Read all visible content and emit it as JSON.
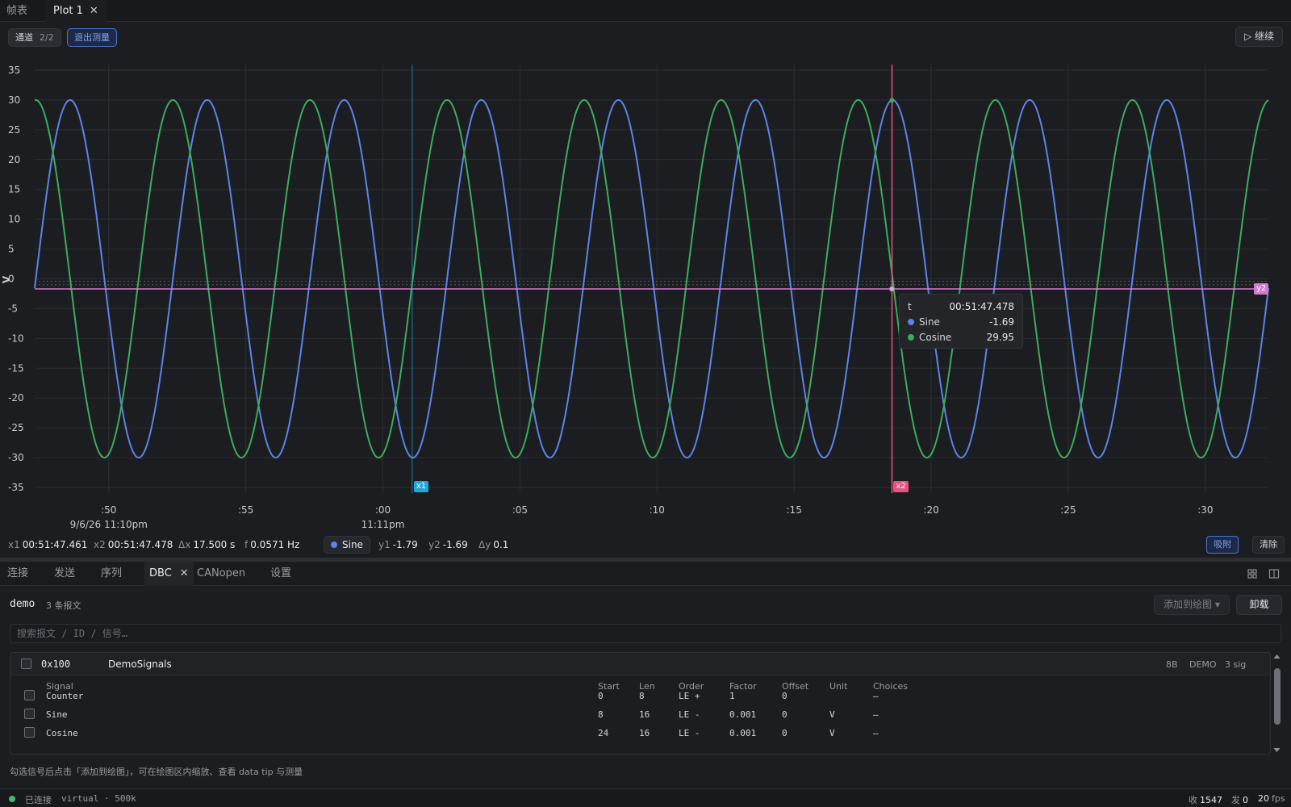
{
  "top_tabs": [
    {
      "label": "帧表",
      "active": false
    },
    {
      "label": "Plot 1",
      "active": true,
      "close": "✕"
    }
  ],
  "toolbar": {
    "channel_label": "通道",
    "channel_count": "2/2",
    "measure_exit_label": "退出测量",
    "continue_label": "▷ 继续"
  },
  "chart_data": {
    "type": "line",
    "ylabel": "V",
    "ylim": [
      -35,
      35
    ],
    "yticks": [
      35,
      30,
      25,
      20,
      15,
      10,
      5,
      0,
      -5,
      -10,
      -15,
      -20,
      -25,
      -30,
      -35
    ],
    "x_range_s": [
      -12.7,
      32.3
    ],
    "xticks": [
      {
        "t": -10,
        "label": ":50",
        "sub": "9/6/26 11:10pm"
      },
      {
        "t": -5,
        "label": ":55"
      },
      {
        "t": 0,
        "label": ":00",
        "sub": "11:11pm"
      },
      {
        "t": 5,
        "label": ":05"
      },
      {
        "t": 10,
        "label": ":10"
      },
      {
        "t": 15,
        "label": ":15"
      },
      {
        "t": 20,
        "label": ":20"
      },
      {
        "t": 25,
        "label": ":25"
      },
      {
        "t": 30,
        "label": ":30"
      }
    ],
    "series": [
      {
        "name": "Sine",
        "color": "#5b84e6",
        "amplitude": 30,
        "frequency_hz": 0.2,
        "phase_deg": -3
      },
      {
        "name": "Cosine",
        "color": "#3dab5c",
        "amplitude": 30,
        "frequency_hz": 0.2,
        "phase_deg": 87
      }
    ],
    "grid": true,
    "cursors": {
      "x1": {
        "t": 1.07,
        "label": "x1",
        "color": "#22a6d8"
      },
      "x2": {
        "t": 18.57,
        "label": "x2",
        "color": "#e8527e"
      },
      "y2": {
        "value": -1.69,
        "label": "y2",
        "color": "#d27ad0"
      },
      "y1": {
        "value": -1.0
      }
    }
  },
  "tooltip": {
    "t_label": "t",
    "t_value": "00:51:47.478",
    "rows": [
      {
        "name": "Sine",
        "value": "-1.69",
        "color": "#5b84e6"
      },
      {
        "name": "Cosine",
        "value": "29.95",
        "color": "#3dab5c"
      }
    ]
  },
  "measure": {
    "x1_label": "x1",
    "x1_value": "00:51:47.461",
    "x2_label": "x2",
    "x2_value": "00:51:47.478",
    "dx_label": "Δx",
    "dx_value": "17.500 s",
    "f_label": "f",
    "f_value": "0.0571 Hz",
    "signal": "Sine",
    "y1_label": "y1",
    "y1_value": "-1.79",
    "y2_label": "y2",
    "y2_value": "-1.69",
    "dy_label": "Δy",
    "dy_value": "0.1",
    "snap_label": "吸附",
    "clear_label": "清除"
  },
  "bottom_tabs": [
    {
      "label": "连接"
    },
    {
      "label": "发送"
    },
    {
      "label": "序列"
    },
    {
      "label": "DBC",
      "active": true,
      "close": "✕"
    },
    {
      "label": "CANopen"
    },
    {
      "label": "设置"
    }
  ],
  "dbc": {
    "name": "demo",
    "message_count": "3 条报文",
    "add_to_plot_label": "添加到绘图 ▾",
    "unload_label": "卸载",
    "search_placeholder": "搜索报文 / ID / 信号…",
    "message": {
      "id": "0x100",
      "name": "DemoSignals",
      "dlc": "8B",
      "node": "DEMO",
      "sig_count": "3 sig"
    },
    "columns": [
      "Signal",
      "Start",
      "Len",
      "Order",
      "Factor",
      "Offset",
      "Unit",
      "Choices"
    ],
    "signals": [
      {
        "name": "Counter",
        "start": "0",
        "len": "8",
        "order": "LE +",
        "factor": "1",
        "offset": "0",
        "unit": "",
        "choices": "—"
      },
      {
        "name": "Sine",
        "start": "8",
        "len": "16",
        "order": "LE -",
        "factor": "0.001",
        "offset": "0",
        "unit": "V",
        "choices": "—"
      },
      {
        "name": "Cosine",
        "start": "24",
        "len": "16",
        "order": "LE -",
        "factor": "0.001",
        "offset": "0",
        "unit": "V",
        "choices": "—"
      }
    ],
    "hint": "勾选信号后点击「添加到绘图」，可在绘图区内缩放、查看 data tip 与测量"
  },
  "status": {
    "connection": "已连接",
    "interface": "virtual · 500k",
    "rx_label": "收",
    "rx_value": "1547",
    "tx_label": "发",
    "tx_value": "0",
    "fps_value": "20",
    "fps_label": "fps"
  },
  "colors": {
    "accent": "#4a74d6",
    "connected": "#3dbb6a"
  }
}
